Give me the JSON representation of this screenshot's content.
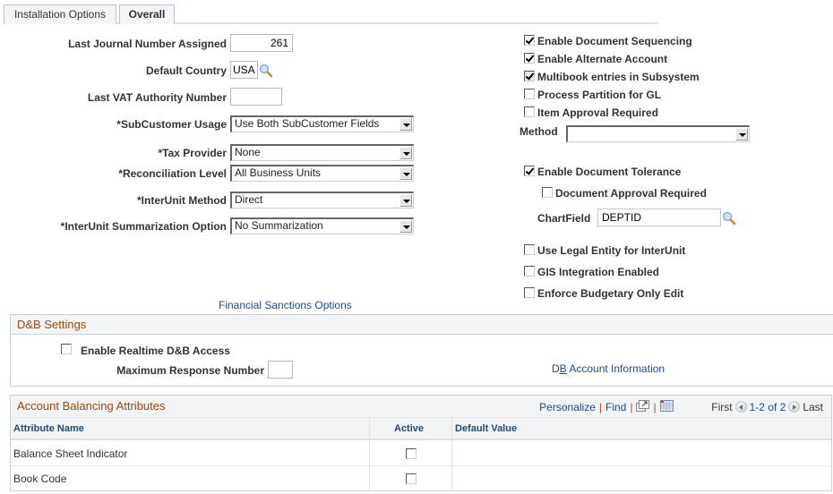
{
  "tabs": [
    {
      "label": "Installation Options",
      "active": false
    },
    {
      "label": "Overall",
      "active": true
    }
  ],
  "left_form": {
    "last_journal_label": "Last Journal Number Assigned",
    "last_journal_value": "261",
    "default_country_label": "Default Country",
    "default_country_value": "USA",
    "last_vat_label": "Last VAT Authority Number",
    "last_vat_value": "",
    "subcustomer_label": "*SubCustomer Usage",
    "subcustomer_value": "Use Both SubCustomer Fields",
    "tax_provider_label": "*Tax Provider",
    "tax_provider_value": "None",
    "reconciliation_label": "*Reconciliation Level",
    "reconciliation_value": "All Business Units",
    "interunit_method_label": "*InterUnit Method",
    "interunit_method_value": "Direct",
    "interunit_summ_label": "*InterUnit Summarization Option",
    "interunit_summ_value": "No Summarization"
  },
  "right_form": {
    "checkboxes_top": [
      {
        "label": "Enable Document Sequencing",
        "checked": true,
        "disabled": false
      },
      {
        "label": "Enable Alternate Account",
        "checked": true,
        "disabled": false
      },
      {
        "label": "Multibook entries in Subsystem",
        "checked": true,
        "disabled": true
      },
      {
        "label": "Process Partition for GL",
        "checked": false,
        "disabled": false
      },
      {
        "label": "Item Approval Required",
        "checked": false,
        "disabled": false
      }
    ],
    "method_label": "Method",
    "method_value": "",
    "enable_doc_tolerance": {
      "label": "Enable Document Tolerance",
      "checked": true
    },
    "doc_approval_required": {
      "label": "Document Approval Required",
      "checked": false
    },
    "chartfield_label": "ChartField",
    "chartfield_value": "DEPTID",
    "checkboxes_bottom": [
      {
        "label": "Use Legal Entity for InterUnit",
        "checked": false
      },
      {
        "label": "GIS Integration Enabled",
        "checked": false
      },
      {
        "label": "Enforce Budgetary Only Edit",
        "checked": false
      }
    ]
  },
  "links": {
    "financial_sanctions": "Financial Sanctions Options",
    "db_account_info_prefix": "D",
    "db_account_info_ul": "B",
    "db_account_info_rest": " Account Information"
  },
  "dnb": {
    "title": "D&B Settings",
    "enable_realtime_label": "Enable Realtime D&B Access",
    "enable_realtime_checked": false,
    "max_response_label": "Maximum Response Number",
    "max_response_value": ""
  },
  "grid": {
    "title": "Account Balancing Attributes",
    "personalize": "Personalize",
    "find": "Find",
    "first": "First",
    "range": "1-2 of 2",
    "last": "Last",
    "columns": [
      "Attribute Name",
      "Active",
      "Default Value"
    ],
    "rows": [
      {
        "attribute": "Balance Sheet Indicator",
        "active": false,
        "default_value": ""
      },
      {
        "attribute": "Book Code",
        "active": false,
        "default_value": ""
      }
    ]
  },
  "colors": {
    "link": "#1f4a8f",
    "section_title": "#9a4a0b",
    "header_bg": "#f1f3f4"
  }
}
